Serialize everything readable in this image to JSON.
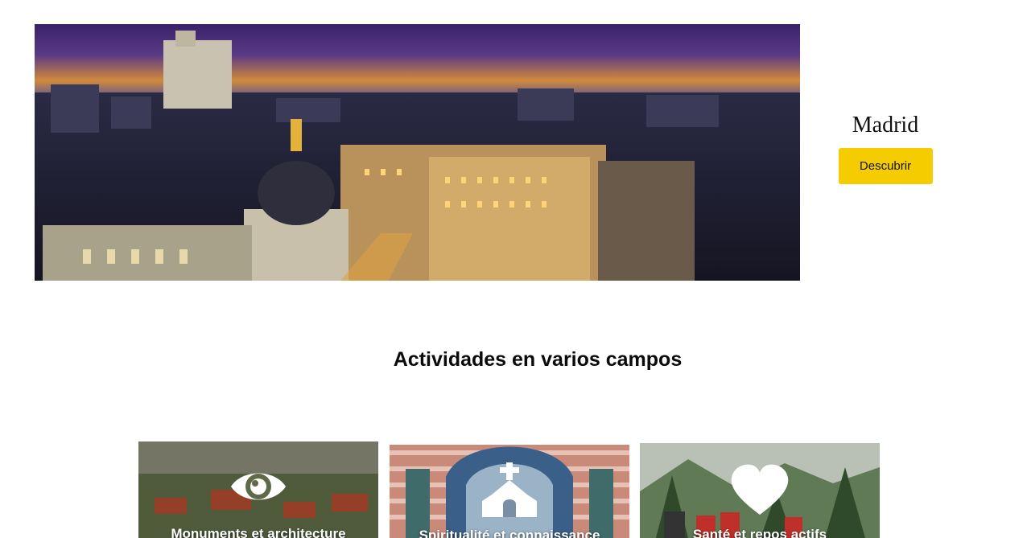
{
  "hero": {
    "image_alt": "Madrid skyline at dusk",
    "title": "Madrid",
    "button_label": "Descubrir",
    "accent_color": "#f5cc00"
  },
  "section": {
    "heading": "Actividades en varios campos"
  },
  "cards": [
    {
      "label": "Monuments et architecture",
      "icon": "eye-icon"
    },
    {
      "label": "Spiritualité et connaissance",
      "icon": "church-icon"
    },
    {
      "label": "Santé et repos actifs",
      "icon": "heart-icon"
    }
  ]
}
